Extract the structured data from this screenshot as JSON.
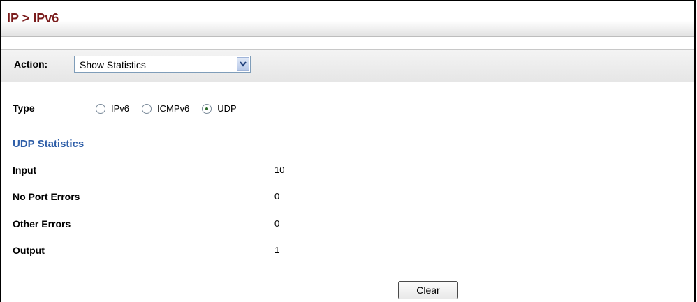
{
  "header": {
    "title": "IP > IPv6"
  },
  "action": {
    "label": "Action:",
    "selected": "Show Statistics"
  },
  "type": {
    "label": "Type",
    "options": [
      {
        "label": "IPv6",
        "checked": false
      },
      {
        "label": "ICMPv6",
        "checked": false
      },
      {
        "label": "UDP",
        "checked": true
      }
    ]
  },
  "stats": {
    "title": "UDP Statistics",
    "rows": [
      {
        "label": "Input",
        "value": "10"
      },
      {
        "label": "No Port Errors",
        "value": "0"
      },
      {
        "label": "Other Errors",
        "value": "0"
      },
      {
        "label": "Output",
        "value": "1"
      }
    ]
  },
  "buttons": {
    "clear": "Clear"
  },
  "colors": {
    "title": "#7a1b1b",
    "section": "#2e5ea8"
  }
}
